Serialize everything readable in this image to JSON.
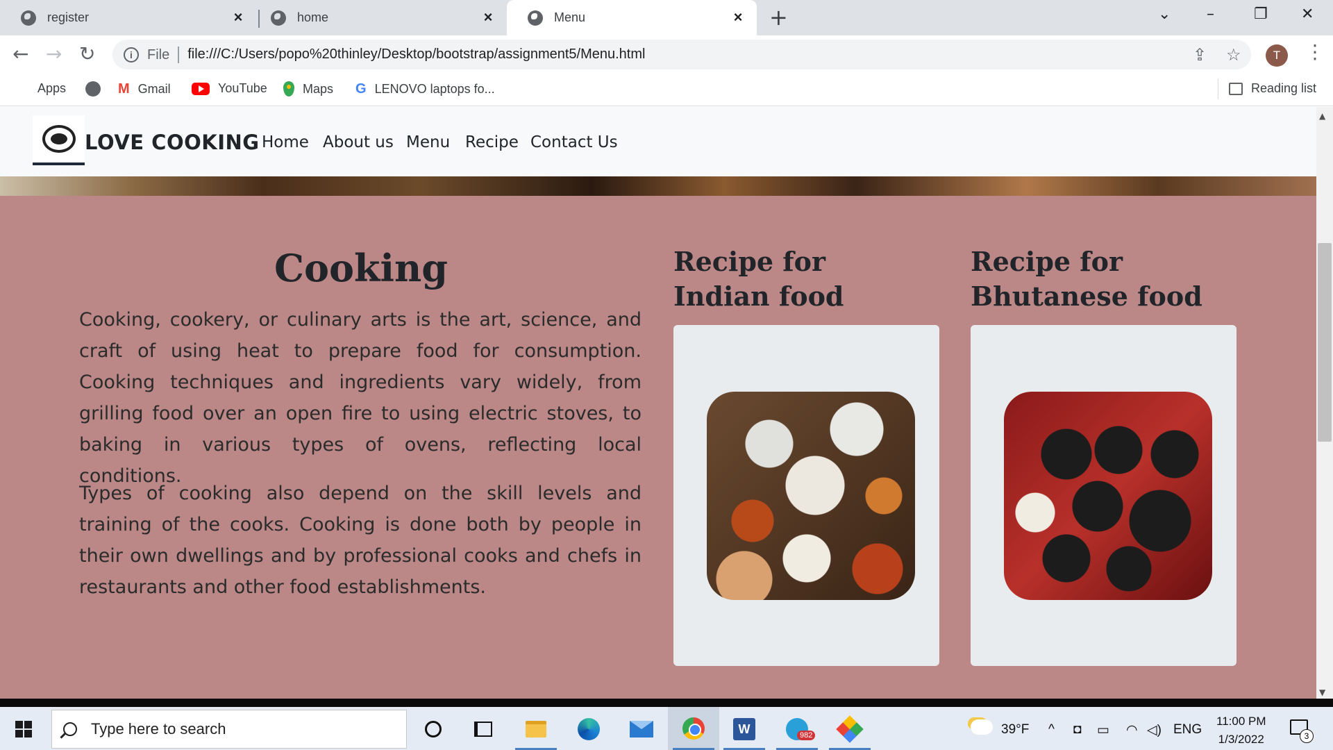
{
  "browser": {
    "tabs": [
      {
        "title": "register",
        "active": false
      },
      {
        "title": "home",
        "active": false
      },
      {
        "title": "Menu",
        "active": true
      }
    ],
    "omnibox": {
      "scheme_label": "File",
      "url": "file:///C:/Users/popo%20thinley/Desktop/bootstrap/assignment5/Menu.html"
    },
    "profile_initial": "T",
    "bookmarks": [
      {
        "label": "Apps",
        "icon": "apps-grid-icon"
      },
      {
        "label": "",
        "icon": "globe-icon"
      },
      {
        "label": "Gmail",
        "icon": "gmail-icon"
      },
      {
        "label": "YouTube",
        "icon": "youtube-icon"
      },
      {
        "label": "Maps",
        "icon": "maps-icon"
      },
      {
        "label": "LENOVO laptops fo...",
        "icon": "google-icon"
      }
    ],
    "reading_list": "Reading list"
  },
  "site": {
    "brand": "LOVE COOKING",
    "nav": [
      "Home",
      "About us",
      "Menu",
      "Recipe",
      "Contact Us"
    ],
    "background_color": "#bb8787",
    "cooking": {
      "title": "Cooking",
      "paragraph1": "Cooking, cookery, or culinary arts is the art, science, and craft of using heat to prepare food for consumption. Cooking techniques and ingredients vary widely, from grilling food over an open fire to using electric stoves, to baking in various types of ovens, reflecting local conditions.",
      "paragraph2": "Types of cooking also depend on the skill levels and training of the cooks. Cooking is done both by people in their own dwellings and by professional cooks and chefs in restaurants and other food establishments."
    },
    "recipes": [
      {
        "title": "Recipe for Indian food"
      },
      {
        "title": "Recipe for Bhutanese food"
      }
    ]
  },
  "taskbar": {
    "search_placeholder": "Type here to search",
    "telegram_badge": "982",
    "temperature": "39°F",
    "language": "ENG",
    "time": "11:00 PM",
    "date": "1/3/2022",
    "notification_count": "3"
  }
}
